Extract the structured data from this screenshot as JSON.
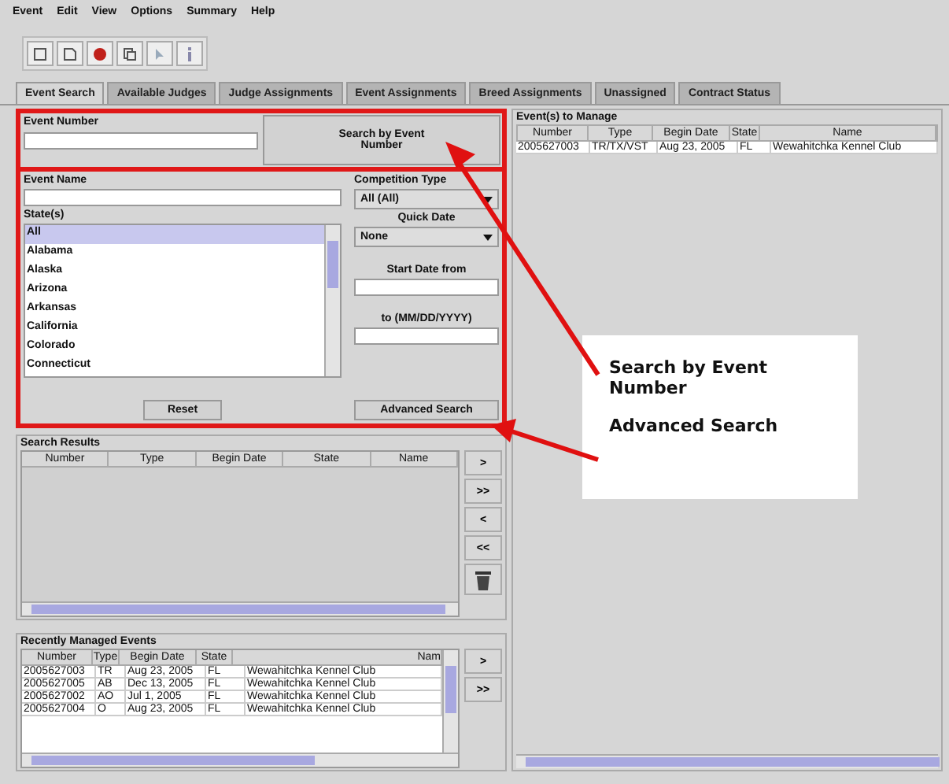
{
  "menu": [
    "Event",
    "Edit",
    "View",
    "Options",
    "Summary",
    "Help"
  ],
  "tabs": [
    {
      "label": "Event Search",
      "selected": true
    },
    {
      "label": "Available Judges",
      "selected": false
    },
    {
      "label": "Judge Assignments",
      "selected": false
    },
    {
      "label": "Event Assignments",
      "selected": false
    },
    {
      "label": "Breed Assignments",
      "selected": false
    },
    {
      "label": "Unassigned",
      "selected": false
    },
    {
      "label": "Contract Status",
      "selected": false
    }
  ],
  "event_number": {
    "label": "Event Number",
    "button": "Search by Event Number"
  },
  "advanced": {
    "event_name_label": "Event Name",
    "competition_type_label": "Competition Type",
    "competition_type_value": "All (All)",
    "states_label": "State(s)",
    "states": [
      {
        "name": "All",
        "selected": true
      },
      {
        "name": "Alabama",
        "selected": false
      },
      {
        "name": "Alaska",
        "selected": false
      },
      {
        "name": "Arizona",
        "selected": false
      },
      {
        "name": "Arkansas",
        "selected": false
      },
      {
        "name": "California",
        "selected": false
      },
      {
        "name": "Colorado",
        "selected": false
      },
      {
        "name": "Connecticut",
        "selected": false
      }
    ],
    "quick_date_label": "Quick Date",
    "quick_date_value": "None",
    "start_label": "Start Date from",
    "to_label": "to (MM/DD/YYYY)",
    "reset_button": "Reset",
    "advanced_button": "Advanced Search"
  },
  "search_results": {
    "title": "Search Results",
    "columns": [
      "Number",
      "Type",
      "Begin Date",
      "State",
      "Name"
    ],
    "side_buttons": [
      ">",
      ">>",
      "<",
      "<<"
    ]
  },
  "recent": {
    "title": "Recently Managed Events",
    "columns": [
      "Number",
      "Type",
      "Begin Date",
      "State",
      "Nam"
    ],
    "rows": [
      [
        "2005627003",
        "TR",
        "Aug 23, 2005",
        "FL",
        "Wewahitchka Kennel Club"
      ],
      [
        "2005627005",
        "AB",
        "Dec 13, 2005",
        "FL",
        "Wewahitchka Kennel Club"
      ],
      [
        "2005627002",
        "AO",
        "Jul 1, 2005",
        "FL",
        "Wewahitchka Kennel Club"
      ],
      [
        "2005627004",
        "O",
        "Aug 23, 2005",
        "FL",
        "Wewahitchka Kennel Club"
      ]
    ],
    "side_buttons": [
      ">",
      ">>"
    ]
  },
  "manage": {
    "title": "Event(s) to Manage",
    "columns": [
      "Number",
      "Type",
      "Begin Date",
      "State",
      "Name"
    ],
    "rows": [
      [
        "2005627003",
        "TR/TX/VST",
        "Aug 23, 2005",
        "FL",
        "Wewahitchka Kennel Club"
      ]
    ]
  },
  "callouts": [
    "Search by Event Number",
    "Advanced Search"
  ]
}
